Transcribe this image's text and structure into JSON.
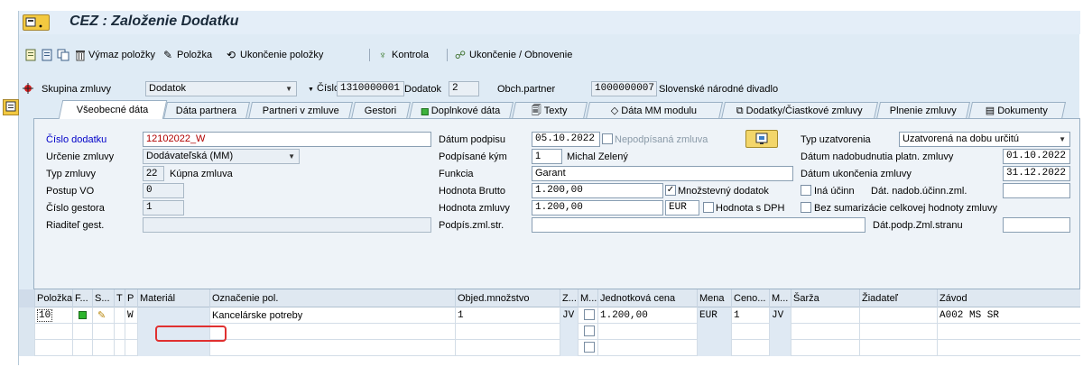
{
  "window": {
    "title": "CEZ : Založenie Dodatku",
    "menu_label": "▣"
  },
  "toolbar": {
    "delete_label": "Výmaz položky",
    "item_label": "Položka",
    "end_item_label": "Ukončenie položky",
    "check_label": "Kontrola",
    "end_renew_label": "Ukončenie / Obnovenie"
  },
  "header": {
    "group_label": "Skupina zmluvy",
    "group_value": "Dodatok",
    "number_label": "Číslo",
    "number_value": "1310000001",
    "addendum_label": "Dodatok",
    "addendum_value": "2",
    "partner_label": "Obch.partner",
    "partner_id": "1000000007",
    "partner_name": "Slovenské národné divadlo"
  },
  "tabs": [
    {
      "label": "Všeobecné dáta",
      "active": true
    },
    {
      "label": "Dáta partnera"
    },
    {
      "label": "Partneri v zmluve"
    },
    {
      "label": "Gestori"
    },
    {
      "label": "Doplnkové dáta",
      "icon": "green-square-icon"
    },
    {
      "label": "Texty",
      "icon": "text-icon"
    },
    {
      "label": "Dáta MM modulu",
      "icon": "diamond-icon"
    },
    {
      "label": "Dodatky/Čiastkové zmluvy",
      "icon": "documents-icon"
    },
    {
      "label": "Plnenie zmluvy"
    },
    {
      "label": "Dokumenty",
      "icon": "document-icon"
    }
  ],
  "form": {
    "cislo_dodatku_label": "Číslo dodatku",
    "cislo_dodatku_value": "12102022_W",
    "urcenie_label": "Určenie zmluvy",
    "urcenie_value": "Dodávateľská (MM)",
    "typ_label": "Typ zmluvy",
    "typ_code": "22",
    "typ_text": "Kúpna zmluva",
    "postup_label": "Postup VO",
    "postup_value": "0",
    "gestor_label": "Číslo gestora",
    "gestor_value": "1",
    "riaditel_label": "Riaditeľ gest.",
    "riaditel_value": "",
    "datum_podpisu_label": "Dátum podpisu",
    "datum_podpisu_value": "05.10.2022",
    "nepodpisana_label": "Nepodpísaná zmluva",
    "podpisane_label": "Podpísané kým",
    "podpisane_code": "1",
    "podpisane_name": "Michal Zelený",
    "funkcia_label": "Funkcia",
    "funkcia_value": "Garant",
    "brutto_label": "Hodnota Brutto",
    "brutto_value": "1.200,00",
    "mnozstevny_label": "Množstevný dodatok",
    "hodnota_label": "Hodnota zmluvy",
    "hodnota_value": "1.200,00",
    "currency": "EUR",
    "hodnota_dph_label": "Hodnota s DPH",
    "podpis_str_label": "Podpís.zml.str.",
    "podpis_str_value": "",
    "typ_uzatv_label": "Typ uzatvorenia",
    "typ_uzatv_value": "Uzatvorená na dobu určitú",
    "datum_nadob_label": "Dátum nadobudnutia platn. zmluvy",
    "datum_nadob_value": "01.10.2022",
    "datum_ukon_label": "Dátum ukončenia zmluvy",
    "datum_ukon_value": "31.12.2022",
    "ina_ucinn_label": "Iná účinn",
    "dat_nadob_ucinn_label": "Dát. nadob.účinn.zml.",
    "bez_sumar_label": "Bez sumarizácie celkovej hodnoty zmluvy",
    "dat_podp_label": "Dát.podp.Zml.stranu"
  },
  "grid": {
    "columns": [
      "Položka",
      "F...",
      "S...",
      "T",
      "P",
      "Materiál",
      "Označenie pol.",
      "Objed.množstvo",
      "Z...",
      "M...",
      "Jednotková cena",
      "Mena",
      "Ceno...",
      "M...",
      "Šarža",
      "Žiadateľ",
      "Závod"
    ],
    "row1": {
      "polozka": "10",
      "p": "W",
      "oznacenie": "Kancelárske potreby",
      "mnozstvo": "1",
      "z": "JV",
      "cena": "1.200,00",
      "mena": "EUR",
      "ceno": "1",
      "m2": "JV",
      "zavod": "A002 MS SR"
    }
  },
  "colors": {
    "frame_bg": "#dfebf5",
    "highlight_red": "#e03030",
    "link_blue": "#0000c8"
  }
}
